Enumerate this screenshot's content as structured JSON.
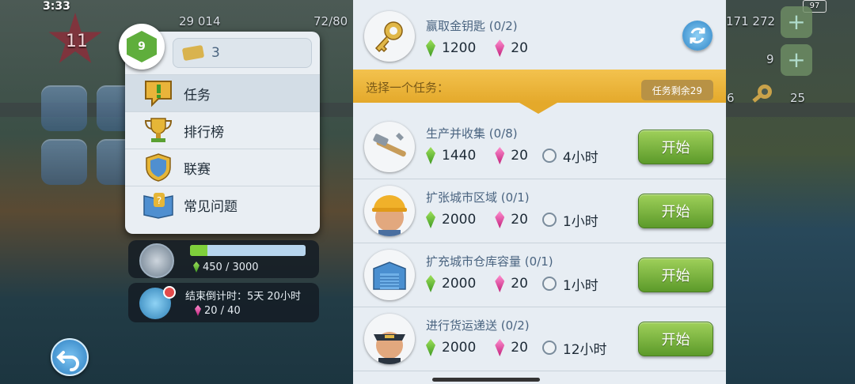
{
  "status_bar": {
    "time": "3:33",
    "battery": "97"
  },
  "hud": {
    "level": "11",
    "population": "29 014",
    "storage": "72/80",
    "simcash": "171 272",
    "simcash_green": "9",
    "keys": "25",
    "side_value": "6"
  },
  "popup": {
    "level": "9",
    "keys": "3",
    "items": [
      {
        "label": "任务",
        "icon": "task-icon"
      },
      {
        "label": "排行榜",
        "icon": "trophy-icon"
      },
      {
        "label": "联赛",
        "icon": "league-shield-icon"
      },
      {
        "label": "常见问题",
        "icon": "faq-book-icon"
      }
    ]
  },
  "progress": {
    "text": "450 / 3000",
    "fraction": 0.15
  },
  "event": {
    "countdown": "结束倒计时：5天 20小时",
    "count": "20 / 40"
  },
  "missions": {
    "top": {
      "title": "赢取金钥匙 (0/2)",
      "green": "1200",
      "pink": "20"
    },
    "banner": {
      "text": "选择一个任务：",
      "remaining": "任务剩余29"
    },
    "start_label": "开始",
    "items": [
      {
        "title": "生产并收集 (0/8)",
        "green": "1440",
        "pink": "20",
        "time": "4小时",
        "avatar": "hammer-wrench-icon"
      },
      {
        "title": "扩张城市区域 (0/1)",
        "green": "2000",
        "pink": "20",
        "time": "1小时",
        "avatar": "worker-avatar"
      },
      {
        "title": "扩充城市仓库容量 (0/1)",
        "green": "2000",
        "pink": "20",
        "time": "1小时",
        "avatar": "warehouse-icon"
      },
      {
        "title": "进行货运递送 (0/2)",
        "green": "2000",
        "pink": "20",
        "time": "12小时",
        "avatar": "captain-avatar"
      }
    ]
  },
  "colors": {
    "green_button": "#7bb843",
    "banner": "#eab63a",
    "panel": "#e7edf3"
  }
}
